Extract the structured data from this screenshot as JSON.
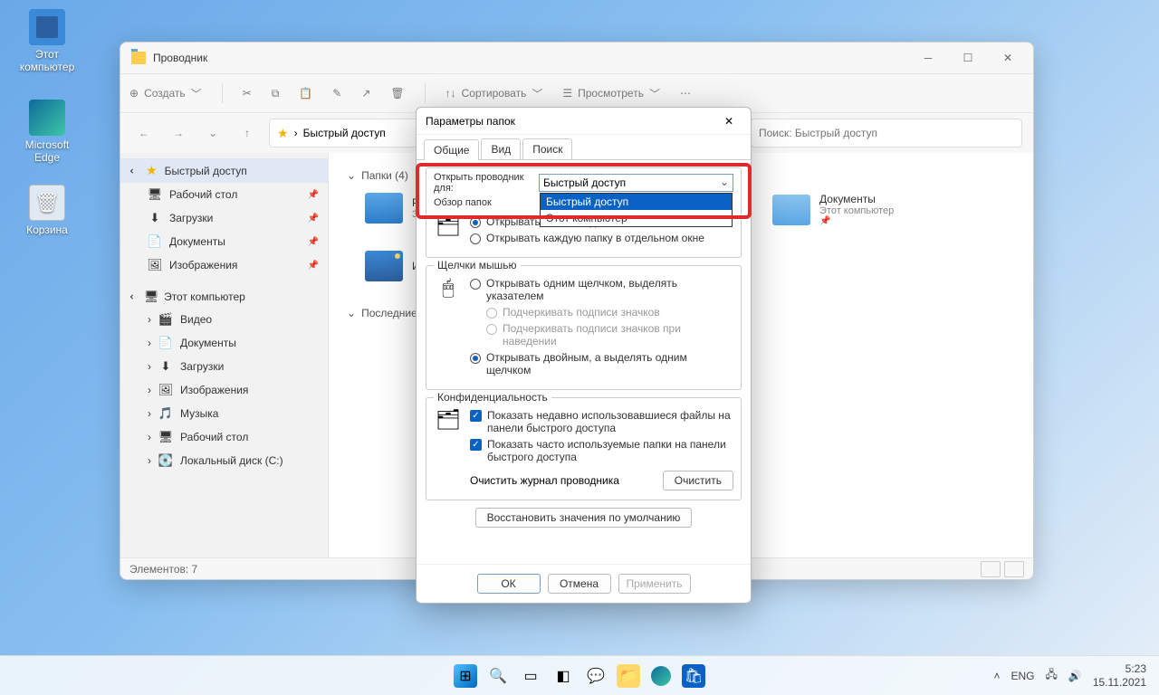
{
  "desktop": {
    "this_pc": "Этот компьютер",
    "edge": "Microsoft Edge",
    "bin": "Корзина"
  },
  "explorer": {
    "title": "Проводник",
    "toolbar": {
      "new": "Создать",
      "sort": "Сортировать",
      "view": "Просмотреть"
    },
    "address": "Быстрый доступ",
    "search_placeholder": "Поиск: Быстрый доступ",
    "sidebar": {
      "quick": "Быстрый доступ",
      "quick_items": [
        "Рабочий стол",
        "Загрузки",
        "Документы",
        "Изображения"
      ],
      "this_pc": "Этот компьютер",
      "pc_items": [
        "Видео",
        "Документы",
        "Загрузки",
        "Изображения",
        "Музыка",
        "Рабочий стол",
        "Локальный диск (C:)"
      ]
    },
    "sections": {
      "folders_head": "Папки (4)",
      "recent_head": "Последние"
    },
    "folders": [
      {
        "name": "Р",
        "sub": "З"
      },
      {
        "name": "И",
        "sub": ""
      },
      {
        "name": "Документы",
        "sub": "Этот компьютер"
      }
    ],
    "status": "Элементов: 7"
  },
  "dialog": {
    "title": "Параметры папок",
    "tabs": [
      "Общие",
      "Вид",
      "Поиск"
    ],
    "open_for_label": "Открыть проводник для:",
    "combo_value": "Быстрый доступ",
    "combo_options": [
      "Быстрый доступ",
      "Этот компьютер"
    ],
    "browse_label": "Обзор папок",
    "browse_opt1": "Открывать папки в одном и том же окне",
    "browse_opt2": "Открывать каждую папку в отдельном окне",
    "clicks_label": "Щелчки мышью",
    "click_opt1": "Открывать одним щелчком, выделять указателем",
    "click_sub1": "Подчеркивать подписи значков",
    "click_sub2": "Подчеркивать подписи значков при наведении",
    "click_opt2": "Открывать двойным, а выделять одним щелчком",
    "privacy_label": "Конфиденциальность",
    "privacy_opt1": "Показать недавно использовавшиеся файлы на панели быстрого доступа",
    "privacy_opt2": "Показать часто используемые папки на панели быстрого доступа",
    "clear_label": "Очистить журнал проводника",
    "clear_btn": "Очистить",
    "restore_btn": "Восстановить значения по умолчанию",
    "ok": "ОК",
    "cancel": "Отмена",
    "apply": "Применить"
  },
  "tray": {
    "lang": "ENG",
    "time": "5:23",
    "date": "15.11.2021"
  }
}
